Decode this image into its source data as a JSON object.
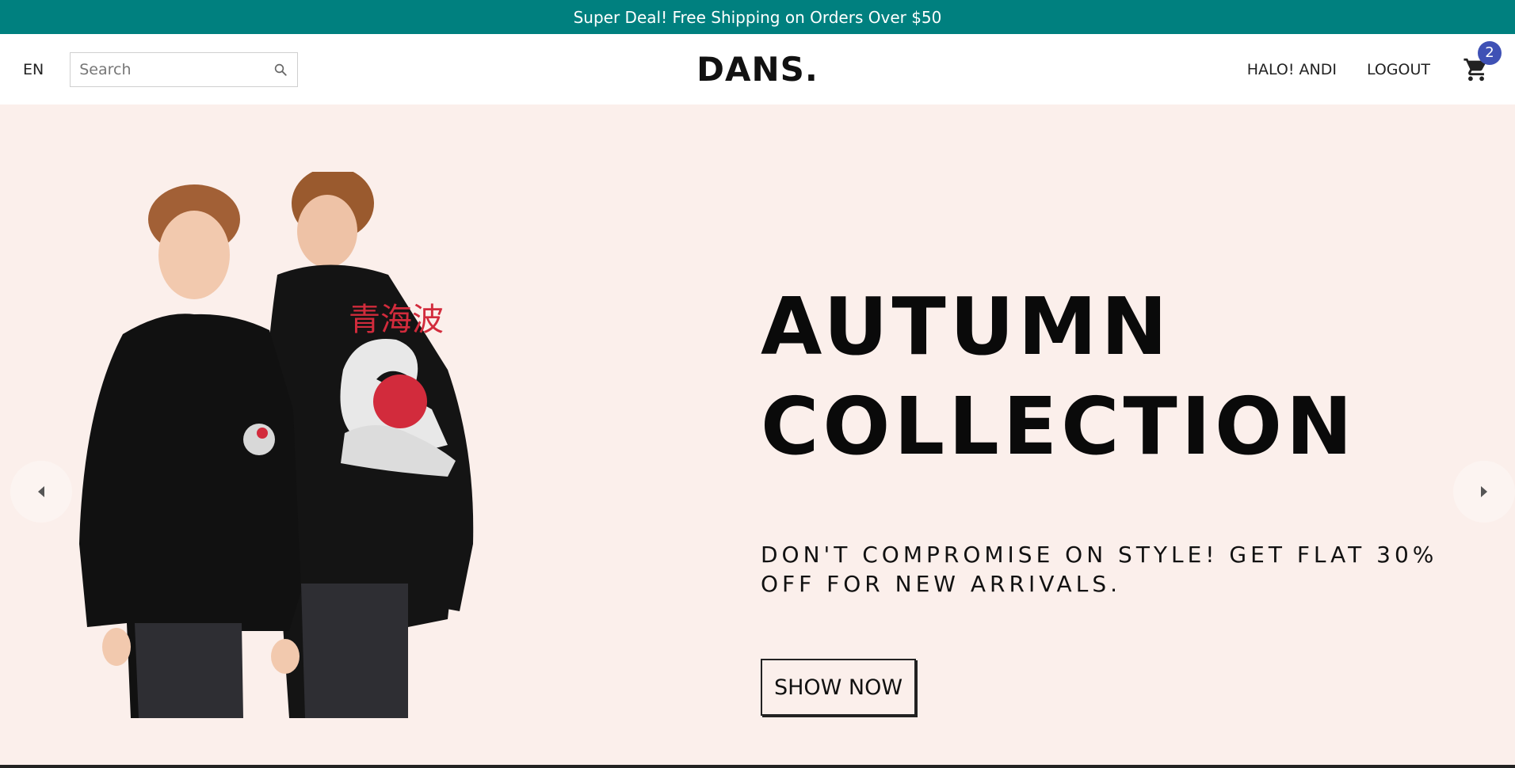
{
  "announcement": {
    "text": "Super Deal! Free Shipping on Orders Over $50",
    "bg_color": "#00807f"
  },
  "navbar": {
    "language": "EN",
    "search": {
      "placeholder": "Search",
      "value": "",
      "icon": "search-icon"
    },
    "logo": "DANS.",
    "greeting": "HALO! ANDI",
    "logout": "LOGOUT",
    "cart": {
      "icon": "shopping-cart-icon",
      "count": "2",
      "badge_color": "#3f51b5"
    }
  },
  "hero": {
    "title_line1": "AUTUMN",
    "title_line2": "COLLECTION",
    "subtitle": "DON'T COMPROMISE ON STYLE! GET FLAT 30% OFF FOR NEW ARRIVALS.",
    "cta_label": "SHOW NOW",
    "bg_color": "#fbefeb",
    "image_alt": "Two models wearing black sweatshirts with wave print",
    "print_text": "青海波",
    "prev_icon": "arrow-left-icon",
    "next_icon": "arrow-right-icon"
  }
}
